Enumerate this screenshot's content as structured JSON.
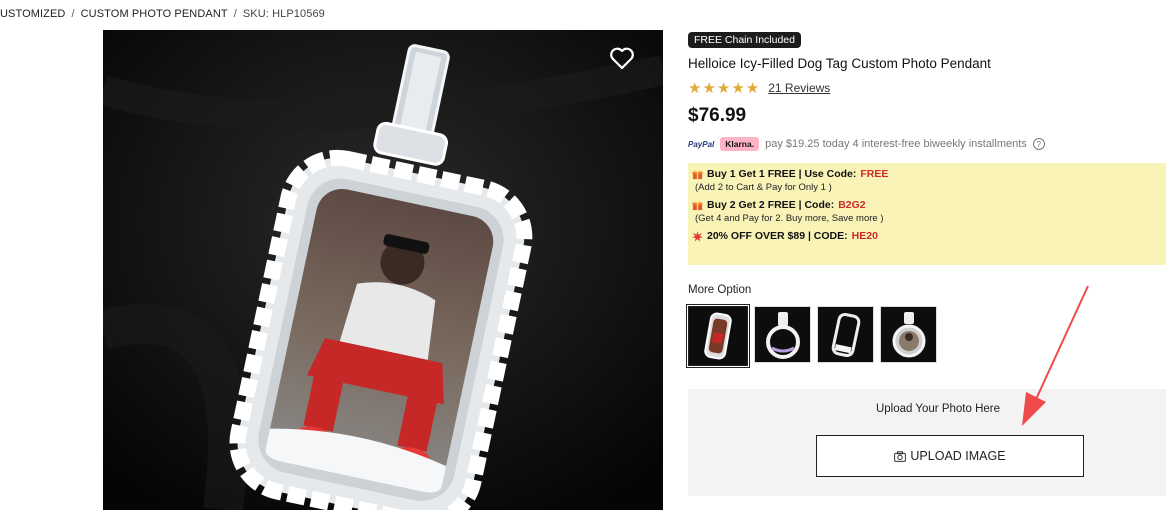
{
  "breadcrumb": {
    "item1": "USTOMIZED",
    "item2": "CUSTOM PHOTO PENDANT",
    "sku": "SKU: HLP10569",
    "separator": "/"
  },
  "product": {
    "badge": "FREE Chain Included",
    "title": "Helloice Icy-Filled Dog Tag Custom Photo Pendant",
    "rating": 5,
    "stars": "★★★★★",
    "reviews": "21 Reviews",
    "price": "$76.99"
  },
  "payment": {
    "paypal_text": "PayPal",
    "klarna_text": "Klarna.",
    "installment": "pay $19.25 today 4 interest-free biweekly installments",
    "help": "?"
  },
  "promos": [
    {
      "title": "Buy 1 Get 1 FREE | Use Code: ",
      "code": "FREE",
      "detail": "(Add 2 to Cart & Pay for Only 1 )",
      "icon": "gift-icon"
    },
    {
      "title": "Buy 2 Get 2 FREE | Code: ",
      "code": "B2G2",
      "detail": "(Get 4 and Pay for 2. Buy more, Save more )",
      "icon": "gift-icon"
    },
    {
      "title": "20% OFF OVER $89 | CODE: ",
      "code": "HE20",
      "detail": "",
      "icon": "burst-icon"
    }
  ],
  "options": {
    "label": "More Option",
    "items": [
      "dog-tag-photo",
      "round-ring-pendant",
      "dog-tag-frame",
      "round-photo-pendant"
    ],
    "selected_index": 0
  },
  "upload": {
    "label": "Upload Your Photo Here",
    "button": "UPLOAD IMAGE",
    "icon": "camera-icon"
  },
  "colors": {
    "promo_bg": "#faf3b8",
    "code_red": "#c92a2a",
    "star_gold": "#e0a93a",
    "annotation_arrow": "#f04a4a"
  }
}
